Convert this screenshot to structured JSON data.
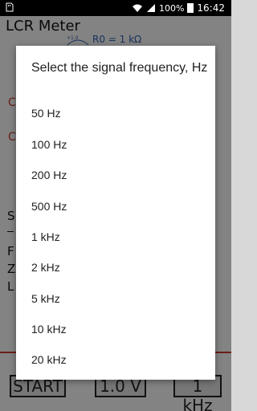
{
  "status_bar": {
    "battery": "100%",
    "time": "16:42"
  },
  "background_app": {
    "title": "LCR Meter",
    "r0_label": "R0 = 1 kΩ",
    "scale_mark": "+1.0",
    "left_fragments": [
      "S",
      "F",
      "Z",
      "L"
    ],
    "buttons": {
      "start": "START",
      "voltage": "1.0 V",
      "frequency": "1 kHz"
    }
  },
  "dialog": {
    "title": "Select the signal frequency, Hz",
    "options": [
      "50 Hz",
      "100 Hz",
      "200 Hz",
      "500 Hz",
      "1 kHz",
      "2 kHz",
      "5 kHz",
      "10 kHz",
      "20 kHz"
    ]
  }
}
